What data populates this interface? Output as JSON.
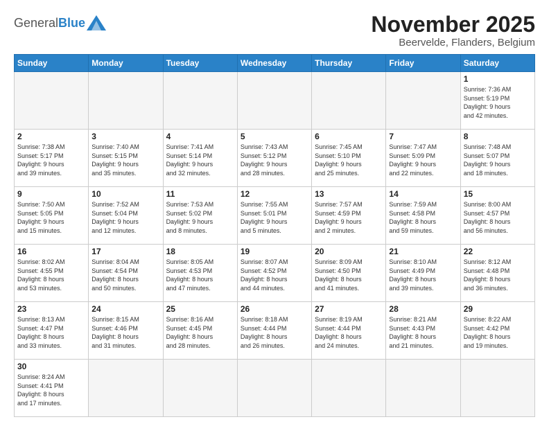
{
  "header": {
    "logo": {
      "general": "General",
      "blue": "Blue"
    },
    "title": "November 2025",
    "location": "Beervelde, Flanders, Belgium"
  },
  "weekdays": [
    "Sunday",
    "Monday",
    "Tuesday",
    "Wednesday",
    "Thursday",
    "Friday",
    "Saturday"
  ],
  "weeks": [
    [
      {
        "day": "",
        "info": ""
      },
      {
        "day": "",
        "info": ""
      },
      {
        "day": "",
        "info": ""
      },
      {
        "day": "",
        "info": ""
      },
      {
        "day": "",
        "info": ""
      },
      {
        "day": "",
        "info": ""
      },
      {
        "day": "1",
        "info": "Sunrise: 7:36 AM\nSunset: 5:19 PM\nDaylight: 9 hours\nand 42 minutes."
      }
    ],
    [
      {
        "day": "2",
        "info": "Sunrise: 7:38 AM\nSunset: 5:17 PM\nDaylight: 9 hours\nand 39 minutes."
      },
      {
        "day": "3",
        "info": "Sunrise: 7:40 AM\nSunset: 5:15 PM\nDaylight: 9 hours\nand 35 minutes."
      },
      {
        "day": "4",
        "info": "Sunrise: 7:41 AM\nSunset: 5:14 PM\nDaylight: 9 hours\nand 32 minutes."
      },
      {
        "day": "5",
        "info": "Sunrise: 7:43 AM\nSunset: 5:12 PM\nDaylight: 9 hours\nand 28 minutes."
      },
      {
        "day": "6",
        "info": "Sunrise: 7:45 AM\nSunset: 5:10 PM\nDaylight: 9 hours\nand 25 minutes."
      },
      {
        "day": "7",
        "info": "Sunrise: 7:47 AM\nSunset: 5:09 PM\nDaylight: 9 hours\nand 22 minutes."
      },
      {
        "day": "8",
        "info": "Sunrise: 7:48 AM\nSunset: 5:07 PM\nDaylight: 9 hours\nand 18 minutes."
      }
    ],
    [
      {
        "day": "9",
        "info": "Sunrise: 7:50 AM\nSunset: 5:05 PM\nDaylight: 9 hours\nand 15 minutes."
      },
      {
        "day": "10",
        "info": "Sunrise: 7:52 AM\nSunset: 5:04 PM\nDaylight: 9 hours\nand 12 minutes."
      },
      {
        "day": "11",
        "info": "Sunrise: 7:53 AM\nSunset: 5:02 PM\nDaylight: 9 hours\nand 8 minutes."
      },
      {
        "day": "12",
        "info": "Sunrise: 7:55 AM\nSunset: 5:01 PM\nDaylight: 9 hours\nand 5 minutes."
      },
      {
        "day": "13",
        "info": "Sunrise: 7:57 AM\nSunset: 4:59 PM\nDaylight: 9 hours\nand 2 minutes."
      },
      {
        "day": "14",
        "info": "Sunrise: 7:59 AM\nSunset: 4:58 PM\nDaylight: 8 hours\nand 59 minutes."
      },
      {
        "day": "15",
        "info": "Sunrise: 8:00 AM\nSunset: 4:57 PM\nDaylight: 8 hours\nand 56 minutes."
      }
    ],
    [
      {
        "day": "16",
        "info": "Sunrise: 8:02 AM\nSunset: 4:55 PM\nDaylight: 8 hours\nand 53 minutes."
      },
      {
        "day": "17",
        "info": "Sunrise: 8:04 AM\nSunset: 4:54 PM\nDaylight: 8 hours\nand 50 minutes."
      },
      {
        "day": "18",
        "info": "Sunrise: 8:05 AM\nSunset: 4:53 PM\nDaylight: 8 hours\nand 47 minutes."
      },
      {
        "day": "19",
        "info": "Sunrise: 8:07 AM\nSunset: 4:52 PM\nDaylight: 8 hours\nand 44 minutes."
      },
      {
        "day": "20",
        "info": "Sunrise: 8:09 AM\nSunset: 4:50 PM\nDaylight: 8 hours\nand 41 minutes."
      },
      {
        "day": "21",
        "info": "Sunrise: 8:10 AM\nSunset: 4:49 PM\nDaylight: 8 hours\nand 39 minutes."
      },
      {
        "day": "22",
        "info": "Sunrise: 8:12 AM\nSunset: 4:48 PM\nDaylight: 8 hours\nand 36 minutes."
      }
    ],
    [
      {
        "day": "23",
        "info": "Sunrise: 8:13 AM\nSunset: 4:47 PM\nDaylight: 8 hours\nand 33 minutes."
      },
      {
        "day": "24",
        "info": "Sunrise: 8:15 AM\nSunset: 4:46 PM\nDaylight: 8 hours\nand 31 minutes."
      },
      {
        "day": "25",
        "info": "Sunrise: 8:16 AM\nSunset: 4:45 PM\nDaylight: 8 hours\nand 28 minutes."
      },
      {
        "day": "26",
        "info": "Sunrise: 8:18 AM\nSunset: 4:44 PM\nDaylight: 8 hours\nand 26 minutes."
      },
      {
        "day": "27",
        "info": "Sunrise: 8:19 AM\nSunset: 4:44 PM\nDaylight: 8 hours\nand 24 minutes."
      },
      {
        "day": "28",
        "info": "Sunrise: 8:21 AM\nSunset: 4:43 PM\nDaylight: 8 hours\nand 21 minutes."
      },
      {
        "day": "29",
        "info": "Sunrise: 8:22 AM\nSunset: 4:42 PM\nDaylight: 8 hours\nand 19 minutes."
      }
    ],
    [
      {
        "day": "30",
        "info": "Sunrise: 8:24 AM\nSunset: 4:41 PM\nDaylight: 8 hours\nand 17 minutes."
      },
      {
        "day": "",
        "info": ""
      },
      {
        "day": "",
        "info": ""
      },
      {
        "day": "",
        "info": ""
      },
      {
        "day": "",
        "info": ""
      },
      {
        "day": "",
        "info": ""
      },
      {
        "day": "",
        "info": ""
      }
    ]
  ]
}
